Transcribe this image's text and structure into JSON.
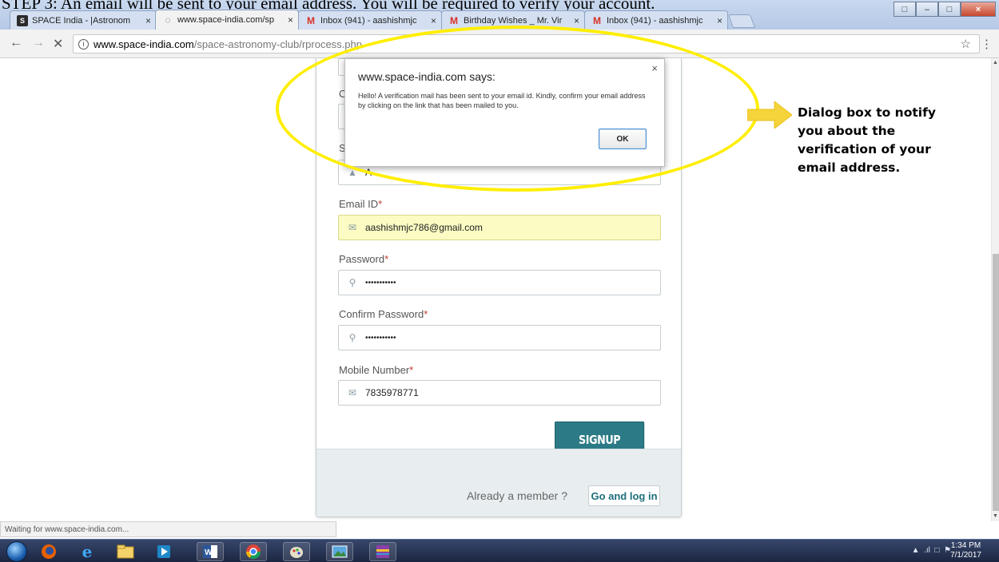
{
  "document": {
    "step_text": "STEP 3: An email will be sent to your email address. You will be required to verify your account."
  },
  "tabs": [
    {
      "title": "SPACE India - |Astronom",
      "favicon": "space-logo-icon"
    },
    {
      "title": "www.space-india.com/sp",
      "favicon": "loading-spinner-icon"
    },
    {
      "title": "Inbox (941) - aashishmjc",
      "favicon": "gmail-icon"
    },
    {
      "title": "Birthday Wishes _ Mr. Vir",
      "favicon": "gmail-icon"
    },
    {
      "title": "Inbox (941) - aashishmjc",
      "favicon": "gmail-icon"
    }
  ],
  "address_bar": {
    "host": "www.space-india.com",
    "path": "/space-astronomy-club/rprocess.php"
  },
  "form": {
    "email_label": "Email ID",
    "email_value": "aashishmjc786@gmail.com",
    "password_label": "Password",
    "password_value": "•••••••••••",
    "confirm_label": "Confirm Password",
    "confirm_value": "•••••••••••",
    "mobile_label": "Mobile Number",
    "mobile_value": "7835978771",
    "required_mark": "*",
    "partial_label_1": "C",
    "partial_label_2": "S",
    "partial_value": "A",
    "signup_label": "SIGNUP",
    "already_member": "Already a member ?",
    "login_label": "Go and log in"
  },
  "dialog": {
    "title": "www.space-india.com says:",
    "message": "Hello! A verification mail has been sent to your email id. Kindly, confirm your email address by clicking on the link that has been mailed to you.",
    "ok_label": "OK",
    "close_glyph": "×"
  },
  "annotation": {
    "text": "Dialog box to notify you about the verification of your email address.",
    "highlight_color": "#ffee00"
  },
  "status": {
    "text": "Waiting for www.space-india.com..."
  },
  "taskbar": {
    "time": "1:34 PM",
    "date": "7/1/2017"
  },
  "colors": {
    "signup_button": "#2c7a86",
    "required_star": "#c0392b",
    "autofill": "#fbfbc3"
  }
}
